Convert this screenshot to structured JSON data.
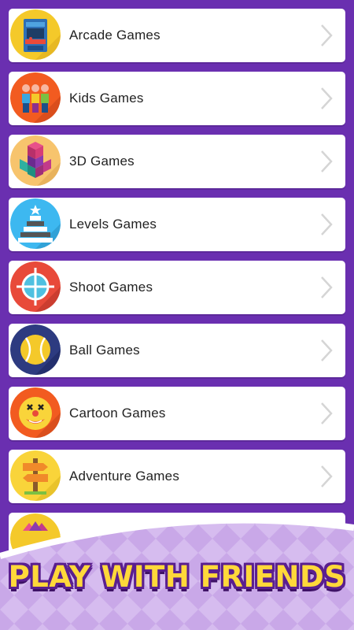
{
  "colors": {
    "background": "#6a2fb0",
    "card": "#ffffff",
    "banner_text": "#ffd83a",
    "banner_outline": "#5a1f8f"
  },
  "categories": [
    {
      "label": "Arcade Games",
      "icon": "arcade-machine-icon",
      "icon_bg": "#f4c92a"
    },
    {
      "label": "Kids Games",
      "icon": "kids-figures-icon",
      "icon_bg": "#f25b20"
    },
    {
      "label": "3D Games",
      "icon": "cubes-icon",
      "icon_bg": "#f7c46d"
    },
    {
      "label": "Levels Games",
      "icon": "stacked-levels-icon",
      "icon_bg": "#3db8f0"
    },
    {
      "label": "Shoot Games",
      "icon": "crosshair-icon",
      "icon_bg": "#e84a3a"
    },
    {
      "label": "Ball Games",
      "icon": "tennis-ball-icon",
      "icon_bg": "#2d3b80"
    },
    {
      "label": "Cartoon Games",
      "icon": "clown-face-icon",
      "icon_bg": "#f25b20"
    },
    {
      "label": "Adventure Games",
      "icon": "signpost-icon",
      "icon_bg": "#f9d43a"
    },
    {
      "label": "",
      "icon": "gems-icon",
      "icon_bg": "#f4c92a"
    }
  ],
  "banner": {
    "text": "PLAY WITH FRIENDS"
  }
}
